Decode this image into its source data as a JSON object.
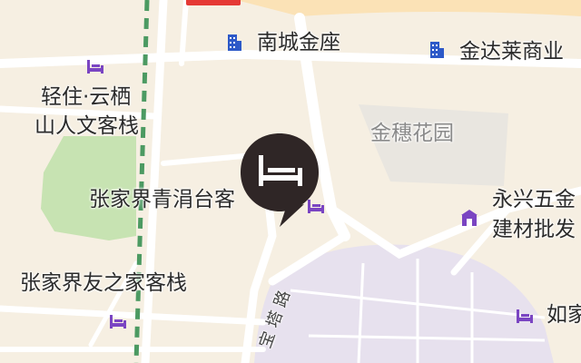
{
  "map": {
    "top_tag": "",
    "road_label": "宝塔路",
    "pois": [
      {
        "id": "nancheng",
        "label": "南城金座",
        "icon": "building-icon",
        "kind": "office"
      },
      {
        "id": "jindalai",
        "label": "金达莱商业",
        "icon": "building-icon",
        "kind": "office"
      },
      {
        "id": "qingzhu",
        "label_lines": [
          "轻住·云栖",
          "山人文客栈"
        ],
        "icon": "bed-icon",
        "kind": "hotel"
      },
      {
        "id": "jinsui",
        "label": "金穗花园",
        "icon": "",
        "kind": "residential"
      },
      {
        "id": "qingjuan",
        "label": "张家界青涓台客",
        "icon": "bed-icon",
        "kind": "hotel"
      },
      {
        "id": "yongxing",
        "label_lines": [
          "永兴五金",
          "建材批发"
        ],
        "icon": "shop-icon",
        "kind": "shop"
      },
      {
        "id": "youzhijia",
        "label": "张家界友之家客栈",
        "icon": "bed-icon",
        "kind": "hotel"
      },
      {
        "id": "rujia",
        "label": "如家",
        "icon": "bed-icon",
        "kind": "hotel"
      }
    ],
    "colors": {
      "background": "#f6efe2",
      "road": "#ffffff",
      "green": "#c7e3b2",
      "purple_area": "#e7e1ee",
      "rail_dash": "#4c9a62",
      "pin": "#2f2626",
      "building_icon": "#2d59c8",
      "bed_icon": "#7a45c2"
    }
  }
}
